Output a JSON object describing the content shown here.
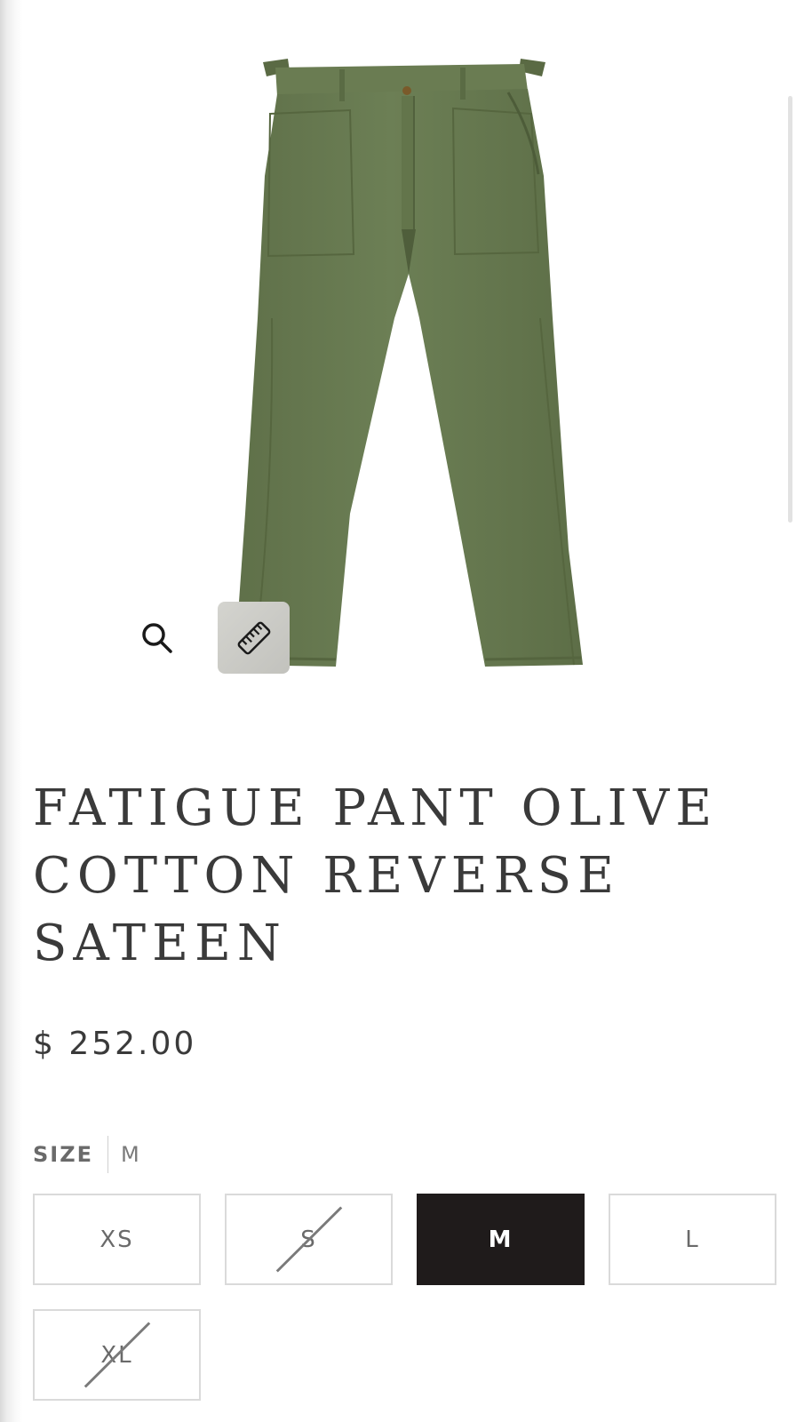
{
  "product": {
    "title": "FATIGUE PANT OLIVE COTTON REVERSE SATEEN",
    "price": "$ 252.00",
    "image_color": "#66784f"
  },
  "gallery": {
    "zoom_icon": "magnifier-icon",
    "size_guide_icon": "ruler-icon"
  },
  "size": {
    "label": "SIZE",
    "selected": "M",
    "options": [
      {
        "label": "XS",
        "available": true,
        "selected": false
      },
      {
        "label": "S",
        "available": false,
        "selected": false
      },
      {
        "label": "M",
        "available": true,
        "selected": true
      },
      {
        "label": "L",
        "available": true,
        "selected": false
      },
      {
        "label": "XL",
        "available": false,
        "selected": false
      }
    ]
  },
  "colors": {
    "text": "#3a3a3a",
    "selected_bg": "#1f1b1b",
    "border": "#dadada"
  }
}
